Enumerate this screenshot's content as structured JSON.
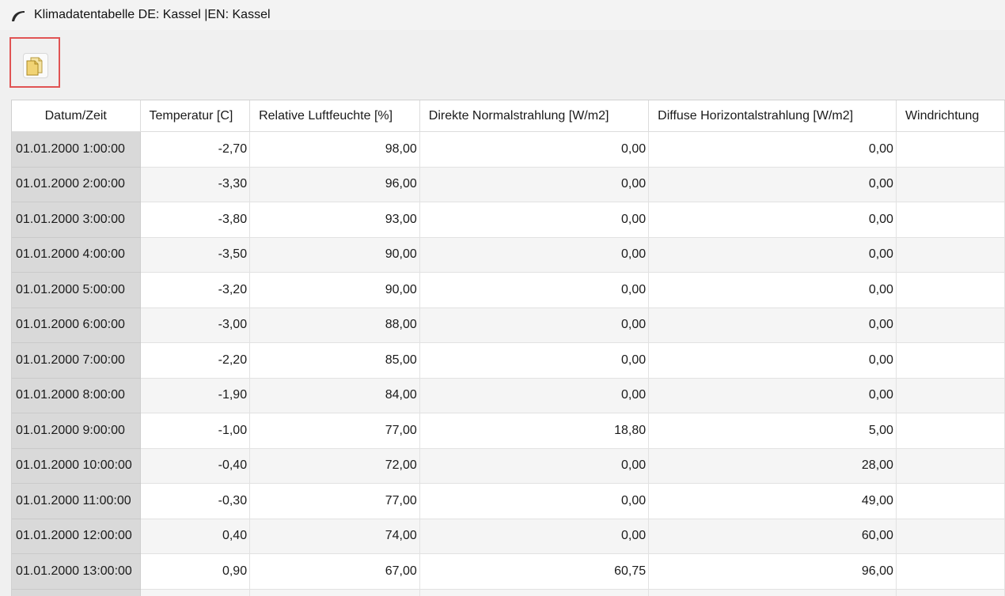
{
  "window": {
    "title": "Klimadatentabelle DE: Kassel |EN: Kassel",
    "app_icon": "curved-blade-icon"
  },
  "toolbar": {
    "copy_button_icon": "copy-documents-icon",
    "highlight_color": "#e05353"
  },
  "table": {
    "columns": [
      "Datum/Zeit",
      "Temperatur [C]",
      "Relative Luftfeuchte [%]",
      "Direkte Normalstrahlung [W/m2]",
      "Diffuse Horizontalstrahlung [W/m2]",
      "Windrichtung"
    ],
    "rows": [
      {
        "datetime": "01.01.2000  1:00:00",
        "temp": "-2,70",
        "rh": "98,00",
        "dni": "0,00",
        "dhi": "0,00",
        "wind": ""
      },
      {
        "datetime": "01.01.2000  2:00:00",
        "temp": "-3,30",
        "rh": "96,00",
        "dni": "0,00",
        "dhi": "0,00",
        "wind": ""
      },
      {
        "datetime": "01.01.2000  3:00:00",
        "temp": "-3,80",
        "rh": "93,00",
        "dni": "0,00",
        "dhi": "0,00",
        "wind": ""
      },
      {
        "datetime": "01.01.2000  4:00:00",
        "temp": "-3,50",
        "rh": "90,00",
        "dni": "0,00",
        "dhi": "0,00",
        "wind": ""
      },
      {
        "datetime": "01.01.2000  5:00:00",
        "temp": "-3,20",
        "rh": "90,00",
        "dni": "0,00",
        "dhi": "0,00",
        "wind": ""
      },
      {
        "datetime": "01.01.2000  6:00:00",
        "temp": "-3,00",
        "rh": "88,00",
        "dni": "0,00",
        "dhi": "0,00",
        "wind": ""
      },
      {
        "datetime": "01.01.2000  7:00:00",
        "temp": "-2,20",
        "rh": "85,00",
        "dni": "0,00",
        "dhi": "0,00",
        "wind": ""
      },
      {
        "datetime": "01.01.2000  8:00:00",
        "temp": "-1,90",
        "rh": "84,00",
        "dni": "0,00",
        "dhi": "0,00",
        "wind": ""
      },
      {
        "datetime": "01.01.2000  9:00:00",
        "temp": "-1,00",
        "rh": "77,00",
        "dni": "18,80",
        "dhi": "5,00",
        "wind": ""
      },
      {
        "datetime": "01.01.2000 10:00:00",
        "temp": "-0,40",
        "rh": "72,00",
        "dni": "0,00",
        "dhi": "28,00",
        "wind": ""
      },
      {
        "datetime": "01.01.2000 11:00:00",
        "temp": "-0,30",
        "rh": "77,00",
        "dni": "0,00",
        "dhi": "49,00",
        "wind": ""
      },
      {
        "datetime": "01.01.2000 12:00:00",
        "temp": "0,40",
        "rh": "74,00",
        "dni": "0,00",
        "dhi": "60,00",
        "wind": ""
      },
      {
        "datetime": "01.01.2000 13:00:00",
        "temp": "0,90",
        "rh": "67,00",
        "dni": "60,75",
        "dhi": "96,00",
        "wind": ""
      }
    ]
  }
}
